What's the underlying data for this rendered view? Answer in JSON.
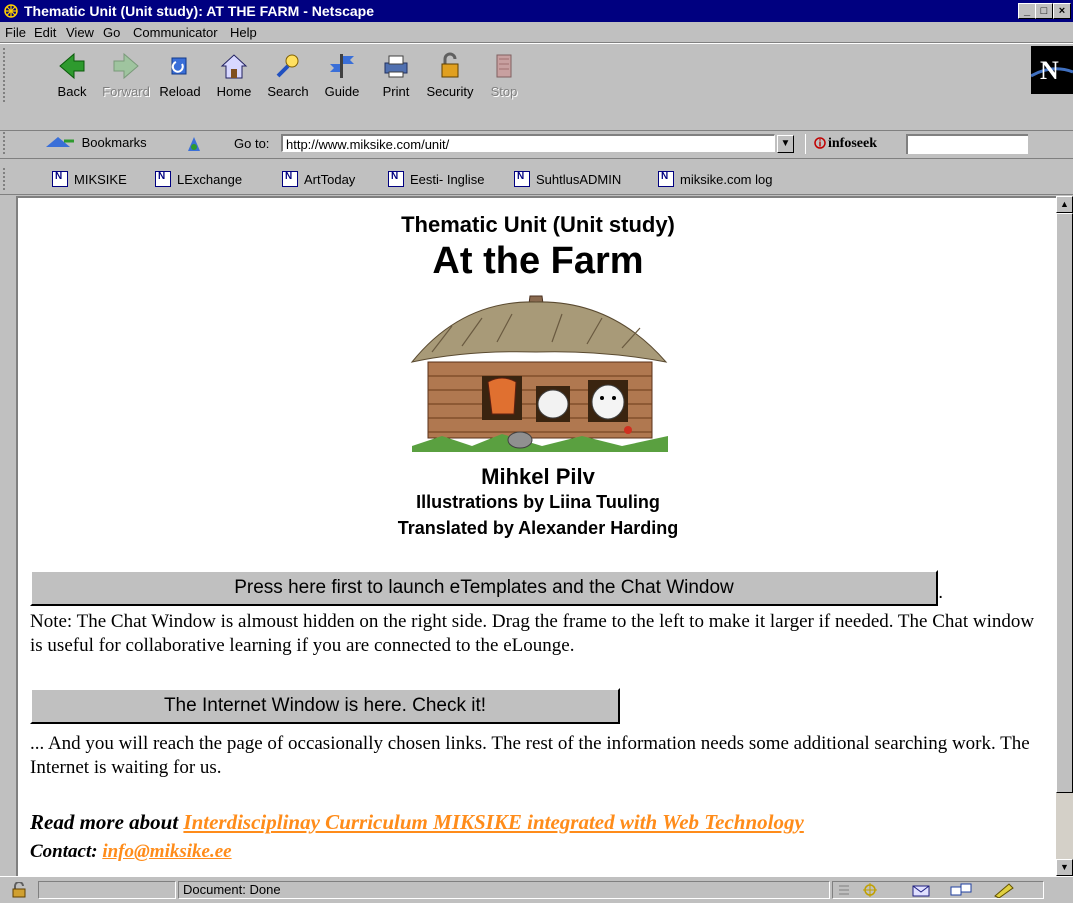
{
  "window": {
    "title": "Thematic Unit (Unit study): AT THE FARM - Netscape"
  },
  "menu": [
    "File",
    "Edit",
    "View",
    "Go",
    "Communicator",
    "Help"
  ],
  "toolbar": {
    "back": "Back",
    "forward": "Forward",
    "reload": "Reload",
    "home": "Home",
    "search": "Search",
    "guide": "Guide",
    "print": "Print",
    "security": "Security",
    "stop": "Stop"
  },
  "location": {
    "bookmarks": "Bookmarks",
    "goto_label": "Go to:",
    "url": "http://www.miksike.com/unit/",
    "infoseek": "infoseek"
  },
  "personal": [
    "MIKSIKE",
    "LExchange",
    "ArtToday",
    "Eesti- Inglise",
    "SuhtlusADMIN",
    "miksike.com log"
  ],
  "page": {
    "subtitle": "Thematic Unit (Unit study)",
    "title": "At the Farm",
    "author": "Mihkel Pilv",
    "illustrations": "Illustrations by Liina Tuuling",
    "translated": "Translated by Alexander Harding",
    "launch_button": "Press here first to launch eTemplates and the Chat Window",
    "launch_after": ".",
    "note": "Note: The Chat Window is almoust hidden on the right side. Drag the frame to the left to make it larger if needed. The Chat window is useful for collaborative learning if you are connected to the eLounge.",
    "internet_button": "The Internet Window is here. Check it!",
    "internet_note": "... And you will reach the page of occasionally chosen links. The rest of the information needs some additional searching work. The Internet is waiting for us.",
    "read_more_label": "Read more about",
    "read_more_link": "Interdisciplinay Curriculum MIKSIKE integrated with Web Technology",
    "contact_label": "Contact:",
    "contact_link": "info@miksike.ee"
  },
  "status": {
    "text": "Document: Done"
  },
  "colors": {
    "titlebar": "#000080",
    "link": "#ff8c1a",
    "chrome": "#c0c0c0"
  }
}
